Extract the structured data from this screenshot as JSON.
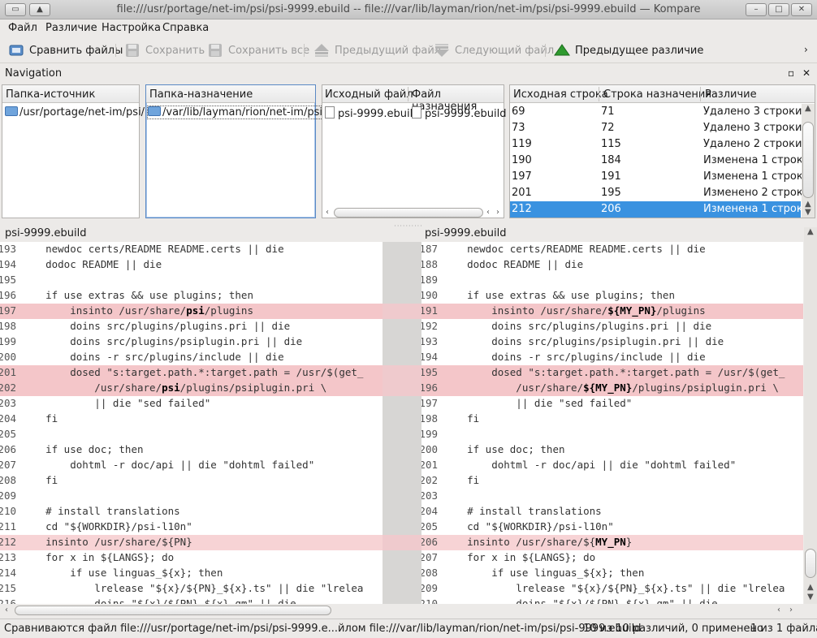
{
  "window": {
    "title": "file:///usr/portage/net-im/psi/psi-9999.ebuild -- file:///var/lib/layman/rion/net-im/psi/psi-9999.ebuild — Kompare"
  },
  "menu": [
    "Файл",
    "Различие",
    "Настройка",
    "Справка"
  ],
  "toolbar": {
    "compare": "Сравнить файлы",
    "save": "Сохранить",
    "save_all": "Сохранить все",
    "prev_file": "Предыдущий файл",
    "next_file": "Следующий файл",
    "prev_diff": "Предыдущее различие"
  },
  "navigation": {
    "label": "Navigation",
    "source_dir": {
      "header": "Папка-источник",
      "value": "/usr/portage/net-im/psi/"
    },
    "dest_dir": {
      "header": "Папка-назначение",
      "value": "/var/lib/layman/rion/net-im/psi/"
    },
    "files": {
      "h_src": "Исходный файл",
      "h_dst": "Файл назначения",
      "src": "psi-9999.ebuild",
      "dst": "psi-9999.ebuild"
    },
    "diffs": {
      "h_src": "Исходная строка",
      "h_dst": "Строка назначения",
      "h_diff": "Различие",
      "rows": [
        {
          "src": "69",
          "dst": "71",
          "desc": "Удалено 3 строки"
        },
        {
          "src": "73",
          "dst": "72",
          "desc": "Удалено 3 строки"
        },
        {
          "src": "119",
          "dst": "115",
          "desc": "Удалено 2 строки"
        },
        {
          "src": "190",
          "dst": "184",
          "desc": "Изменена 1 строка"
        },
        {
          "src": "197",
          "dst": "191",
          "desc": "Изменена 1 строка"
        },
        {
          "src": "201",
          "dst": "195",
          "desc": "Изменено 2 строки"
        },
        {
          "src": "212",
          "dst": "206",
          "desc": "Изменена 1 строка"
        }
      ],
      "selected_index": 6
    }
  },
  "left_doc": {
    "name": "psi-9999.ebuild",
    "lines": [
      {
        "n": "193",
        "t": "    newdoc certs/README README.certs || die",
        "k": ""
      },
      {
        "n": "194",
        "t": "    dodoc README || die",
        "k": ""
      },
      {
        "n": "195",
        "t": "",
        "k": ""
      },
      {
        "n": "196",
        "t": "    if use extras && use plugins; then",
        "k": ""
      },
      {
        "n": "197",
        "t": "        insinto /usr/share/**psi**/plugins",
        "k": "diff"
      },
      {
        "n": "198",
        "t": "        doins src/plugins/plugins.pri || die",
        "k": ""
      },
      {
        "n": "199",
        "t": "        doins src/plugins/psiplugin.pri || die",
        "k": ""
      },
      {
        "n": "200",
        "t": "        doins -r src/plugins/include || die",
        "k": ""
      },
      {
        "n": "201",
        "t": "        dosed \"s:target.path.*:target.path = /usr/$(get_",
        "k": "diff"
      },
      {
        "n": "202",
        "t": "            /usr/share/**psi**/plugins/psiplugin.pri \\",
        "k": "diff"
      },
      {
        "n": "203",
        "t": "            || die \"sed failed\"",
        "k": ""
      },
      {
        "n": "204",
        "t": "    fi",
        "k": ""
      },
      {
        "n": "205",
        "t": "",
        "k": ""
      },
      {
        "n": "206",
        "t": "    if use doc; then",
        "k": ""
      },
      {
        "n": "207",
        "t": "        dohtml -r doc/api || die \"dohtml failed\"",
        "k": ""
      },
      {
        "n": "208",
        "t": "    fi",
        "k": ""
      },
      {
        "n": "209",
        "t": "",
        "k": ""
      },
      {
        "n": "210",
        "t": "    # install translations",
        "k": ""
      },
      {
        "n": "211",
        "t": "    cd \"${WORKDIR}/psi-l10n\"",
        "k": ""
      },
      {
        "n": "212",
        "t": "    insinto /usr/share/${PN}",
        "k": "mod"
      },
      {
        "n": "213",
        "t": "    for x in ${LANGS}; do",
        "k": ""
      },
      {
        "n": "214",
        "t": "        if use linguas_${x}; then",
        "k": ""
      },
      {
        "n": "215",
        "t": "            lrelease \"${x}/${PN}_${x}.ts\" || die \"lrelea",
        "k": ""
      },
      {
        "n": "216",
        "t": "            doins \"${x}/${PN}_${x}.qm\" || die",
        "k": ""
      }
    ]
  },
  "right_doc": {
    "name": "psi-9999.ebuild",
    "lines": [
      {
        "n": "187",
        "t": "    newdoc certs/README README.certs || die",
        "k": ""
      },
      {
        "n": "188",
        "t": "    dodoc README || die",
        "k": ""
      },
      {
        "n": "189",
        "t": "",
        "k": ""
      },
      {
        "n": "190",
        "t": "    if use extras && use plugins; then",
        "k": ""
      },
      {
        "n": "191",
        "t": "        insinto /usr/share/**${MY_PN}**/plugins",
        "k": "diff"
      },
      {
        "n": "192",
        "t": "        doins src/plugins/plugins.pri || die",
        "k": ""
      },
      {
        "n": "193",
        "t": "        doins src/plugins/psiplugin.pri || die",
        "k": ""
      },
      {
        "n": "194",
        "t": "        doins -r src/plugins/include || die",
        "k": ""
      },
      {
        "n": "195",
        "t": "        dosed \"s:target.path.*:target.path = /usr/$(get_",
        "k": "diff"
      },
      {
        "n": "196",
        "t": "            /usr/share/**${MY_PN}**/plugins/psiplugin.pri \\",
        "k": "diff"
      },
      {
        "n": "197",
        "t": "            || die \"sed failed\"",
        "k": ""
      },
      {
        "n": "198",
        "t": "    fi",
        "k": ""
      },
      {
        "n": "199",
        "t": "",
        "k": ""
      },
      {
        "n": "200",
        "t": "    if use doc; then",
        "k": ""
      },
      {
        "n": "201",
        "t": "        dohtml -r doc/api || die \"dohtml failed\"",
        "k": ""
      },
      {
        "n": "202",
        "t": "    fi",
        "k": ""
      },
      {
        "n": "203",
        "t": "",
        "k": ""
      },
      {
        "n": "204",
        "t": "    # install translations",
        "k": ""
      },
      {
        "n": "205",
        "t": "    cd \"${WORKDIR}/psi-l10n\"",
        "k": ""
      },
      {
        "n": "206",
        "t": "    insinto /usr/share/${**MY_PN**}",
        "k": "mod"
      },
      {
        "n": "207",
        "t": "    for x in ${LANGS}; do",
        "k": ""
      },
      {
        "n": "208",
        "t": "        if use linguas_${x}; then",
        "k": ""
      },
      {
        "n": "209",
        "t": "            lrelease \"${x}/${PN}_${x}.ts\" || die \"lrelea",
        "k": ""
      },
      {
        "n": "210",
        "t": "            doins \"${x}/${PN}_${x}.qm\" || die",
        "k": ""
      }
    ]
  },
  "status": {
    "compare": "Сравниваются файл file:///usr/portage/net-im/psi/psi-9999.e...йлом file:///var/lib/layman/rion/net-im/psi/psi-9999.ebuild",
    "diffs": "10 из 10 различий, 0 применено",
    "files": "1 из 1 файла"
  },
  "colors": {
    "accent": "#3a92e0",
    "diff": "#f4c6c9",
    "add_icon": "#2e9a2e"
  }
}
